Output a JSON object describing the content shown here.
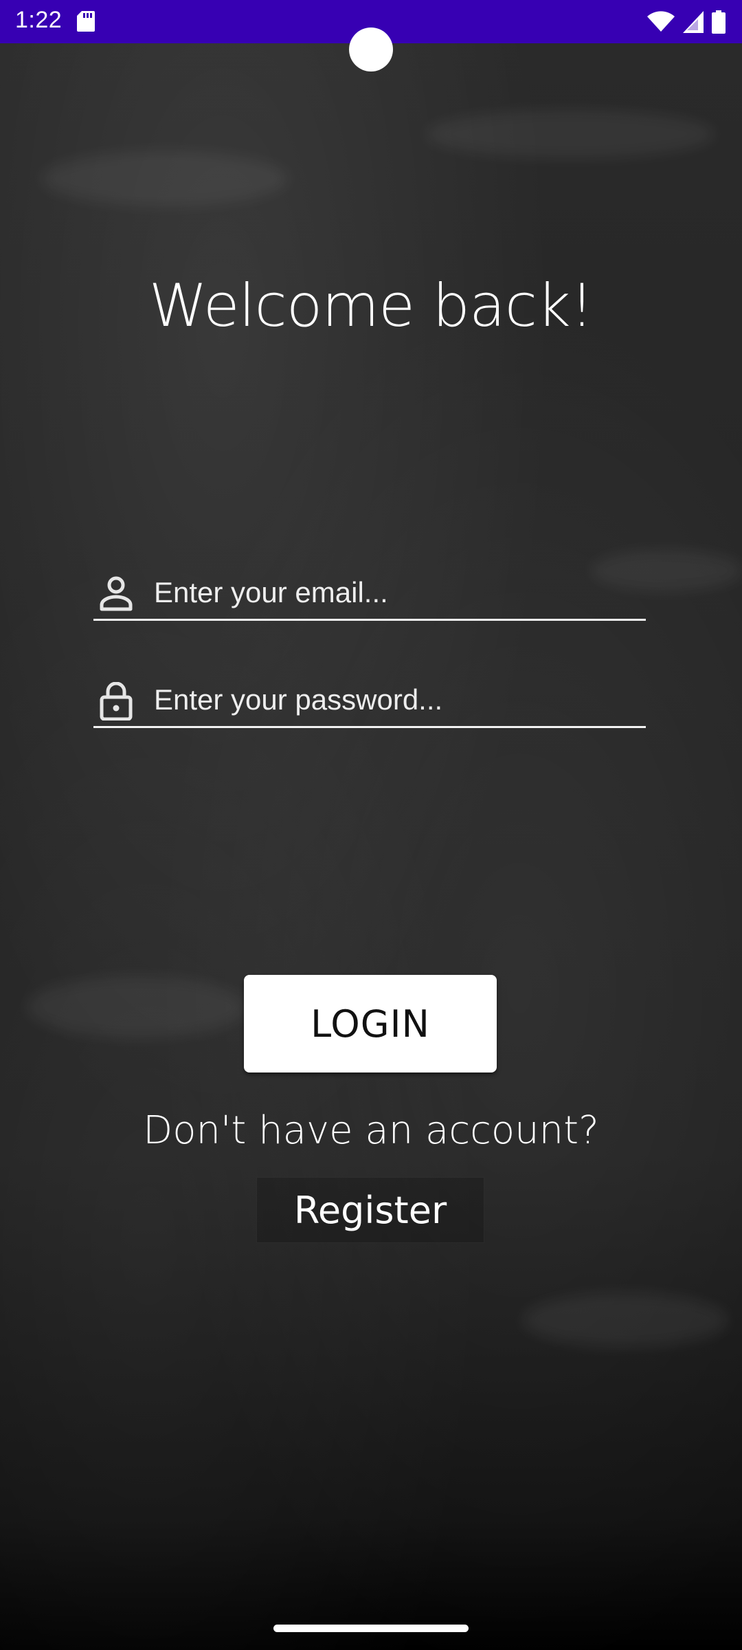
{
  "status_bar": {
    "time": "1:22",
    "background": "#3700b3",
    "icons": [
      "sd-card-icon",
      "wifi-icon",
      "signal-icon",
      "battery-icon"
    ]
  },
  "login": {
    "title": "Welcome back!",
    "email_placeholder": "Enter your email...",
    "password_placeholder": "Enter your password...",
    "login_label": "LOGIN",
    "no_account_text": "Don't have an account?",
    "register_label": "Register"
  },
  "icons": {
    "email": "person-icon",
    "password": "lock-icon"
  }
}
